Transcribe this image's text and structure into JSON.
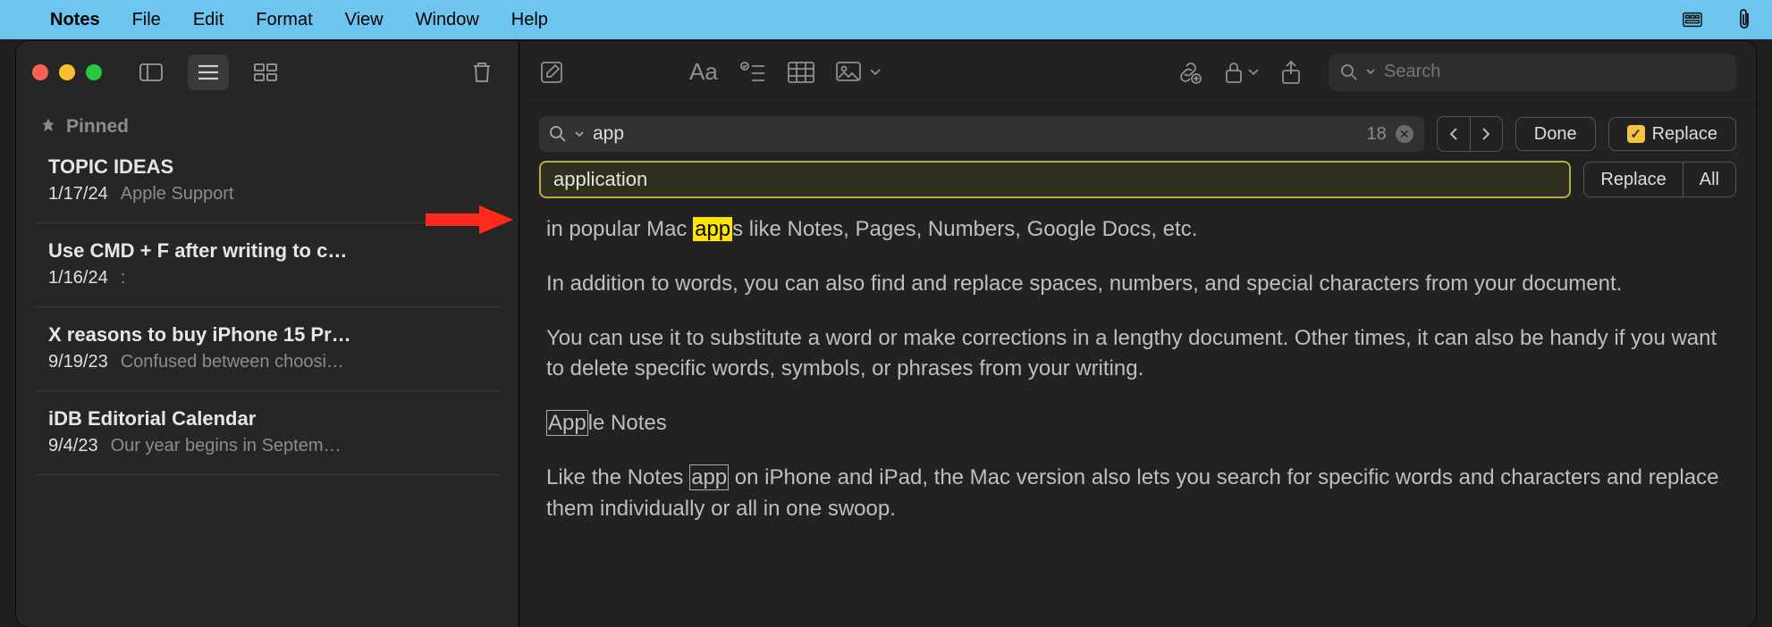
{
  "menubar": {
    "app_name": "Notes",
    "items": [
      "File",
      "Edit",
      "Format",
      "View",
      "Window",
      "Help"
    ]
  },
  "sidebar": {
    "pinned_label": "Pinned",
    "notes": [
      {
        "title": "TOPIC IDEAS",
        "date": "1/17/24",
        "preview": "Apple Support"
      },
      {
        "title": "Use CMD + F after writing to c…",
        "date": "1/16/24",
        "preview": ":"
      },
      {
        "title": "X reasons to buy iPhone 15 Pr…",
        "date": "9/19/23",
        "preview": "Confused between choosi…"
      },
      {
        "title": "iDB Editorial Calendar",
        "date": "9/4/23",
        "preview": "Our year begins in Septem…"
      }
    ]
  },
  "toolbar": {
    "search_placeholder": "Search"
  },
  "find": {
    "query": "app",
    "count": "18",
    "done_label": "Done",
    "replace_toggle_label": "Replace",
    "replace_value": "application",
    "replace_btn": "Replace",
    "all_btn": "All"
  },
  "body": {
    "p1_pre": "in popular Mac ",
    "p1_match": "app",
    "p1_post": "s like Notes, Pages, Numbers, Google Docs, etc.",
    "p2": "In addition to words, you can also find and replace spaces, numbers, and special characters from your document.",
    "p3": "You can use it to substitute a word or make corrections in a lengthy document. Other times, it can also be handy if you want to delete specific words, symbols, or phrases from your writing.",
    "p4_match": "App",
    "p4_rest": "le Notes",
    "p5_pre": "Like the Notes ",
    "p5_match": "app",
    "p5_post": " on iPhone and iPad, the Mac version also lets you search for specific words and characters and replace them individually or all in one swoop."
  }
}
